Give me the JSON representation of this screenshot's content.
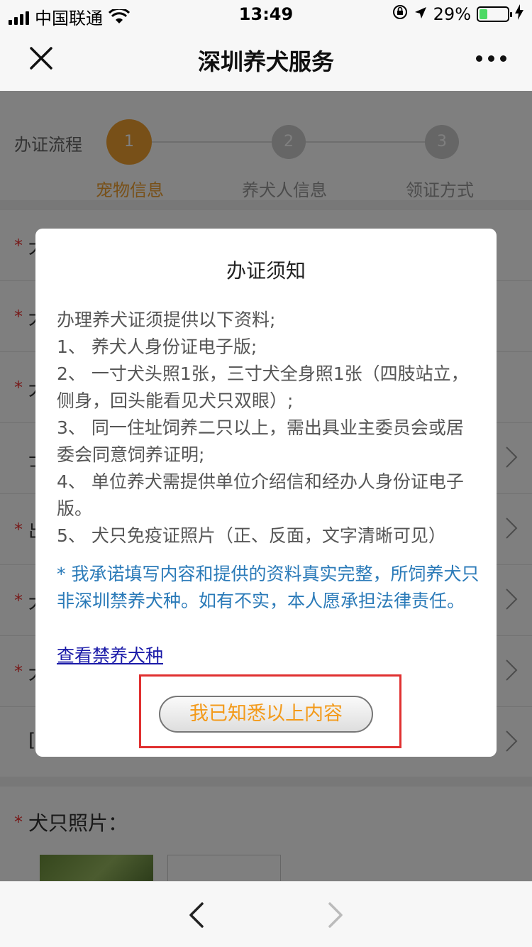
{
  "status_bar": {
    "carrier": "中国联通",
    "time": "13:49",
    "battery_percent": "29%",
    "battery_level": 0.29
  },
  "nav": {
    "title": "深圳养犬服务",
    "close_icon": "close-icon",
    "more_icon": "more-icon"
  },
  "steps": {
    "label": "办证流程",
    "items": [
      {
        "number": "1",
        "label": "宠物信息",
        "active": true
      },
      {
        "number": "2",
        "label": "养犬人信息",
        "active": false
      },
      {
        "number": "3",
        "label": "领证方式",
        "active": false
      }
    ],
    "active_color": "#f0a030"
  },
  "form": {
    "rows": [
      {
        "star": "*",
        "label": "犬"
      },
      {
        "star": "*",
        "label": "犬"
      },
      {
        "star": "*",
        "label": "犬"
      },
      {
        "star": "",
        "label": "士"
      },
      {
        "star": "*",
        "label": "出"
      },
      {
        "star": "*",
        "label": "犬"
      },
      {
        "star": "*",
        "label": "犬"
      },
      {
        "star": "",
        "label": "["
      }
    ]
  },
  "photos": {
    "star": "*",
    "label": "犬只照片："
  },
  "modal": {
    "title": "办证须知",
    "intro": "办理养犬证须提供以下资料;",
    "items": [
      "1、 养犬人身份证电子版;",
      "2、 一寸犬头照1张，三寸犬全身照1张（四肢站立，侧身，回头能看见犬只双眼）;",
      "3、 同一住址饲养二只以上，需出具业主委员会或居委会同意饲养证明;",
      "4、 单位养犬需提供单位介绍信和经办人身份证电子版。",
      "5、 犬只免疫证照片（正、反面，文字清晰可见）"
    ],
    "notice": "* 我承诺填写内容和提供的资料真实完整，所饲养犬只非深圳禁养犬种。如有不实，本人愿承担法律责任。",
    "link": "查看禁养犬种",
    "button": "我已知悉以上内容"
  },
  "colors": {
    "accent": "#f0a030",
    "notice_text": "#2a7ab8",
    "link_text": "#1a1aa8",
    "highlight_border": "#e03030"
  },
  "bottom_bar": {
    "back_icon": "chevron-left-icon",
    "forward_icon": "chevron-right-icon"
  }
}
